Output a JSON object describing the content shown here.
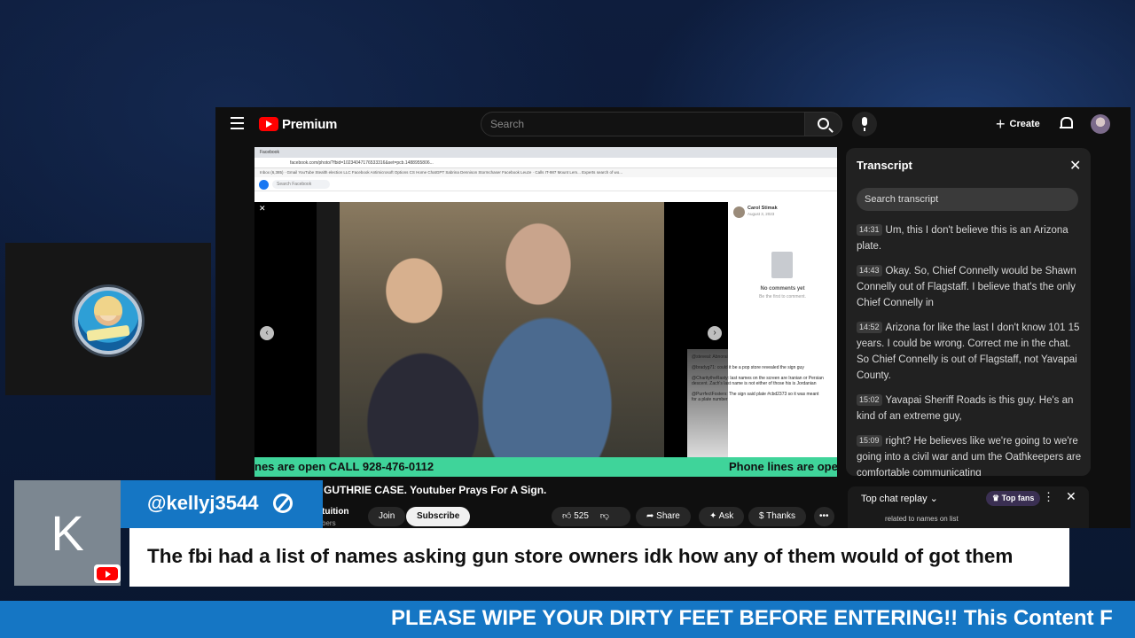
{
  "youtube": {
    "logo_text": "Premium",
    "search_placeholder": "Search",
    "create_label": "Create"
  },
  "video": {
    "browser_tab": "Facebook",
    "address": "facebook.com/photo/?fbid=10234047176533316&set=pcb.1488955806...",
    "bookmarks": "Inbox (6,385) · Gmail   YouTube   Stealth election LLC   Facebook   Antimicrosoft Options   CS Home   ChatGPT   Sabrina Dennison   Stormchaser   Facebook   Leuze · Calls   IT-987 Mount Lem...   Experts search of wo...",
    "fb_search_placeholder": "Search Facebook",
    "poster_name": "Carol Stimak",
    "poster_date": "August 3, 2023",
    "no_comments": "No comments yet",
    "be_first": "Be the first to comment.",
    "overlay_chat": [
      "@steveal: Abnorai",
      "@bradyg71: could it be a pop store revealed the sign guy",
      "@CharitytheRasty: last names on the screen are Iranian or Persian descent. Zach's last name is not either of those his is Jordanian",
      "@PurrfectFosters: The sign said plate #cbd2373 so it was meant for a plate number"
    ],
    "banner_text": "nes are open CALL 928-476-0112",
    "banner_text_2": "Phone lines are ope"
  },
  "title": "GUTHRIE CASE. Youtuber Prays For A Sign.",
  "channel": {
    "name": "tuition",
    "subs": "bers"
  },
  "actions": {
    "join": "Join",
    "subscribe": "Subscribe",
    "likes": "525",
    "share": "Share",
    "ask": "Ask",
    "thanks": "Thanks"
  },
  "transcript": {
    "title": "Transcript",
    "search_placeholder": "Search transcript",
    "items": [
      {
        "time": "14:31",
        "text": "Um, this I don't believe this is an Arizona plate."
      },
      {
        "time": "14:43",
        "text": "Okay. So, Chief Connelly would be Shawn Connelly out of Flagstaff. I believe that's the only Chief Connelly in"
      },
      {
        "time": "14:52",
        "text": "Arizona for like the last I don't know 101 15 years. I could be wrong. Correct me in the chat. So Chief Connelly is out of Flagstaff, not Yavapai County."
      },
      {
        "time": "15:02",
        "text": "Yavapai Sheriff Roads is this guy. He's an kind of an extreme guy,"
      },
      {
        "time": "15:09",
        "text": "right? He believes like we're going to we're going into a civil war and um the Oathkeepers are comfortable communicating"
      }
    ]
  },
  "live_chat": {
    "label": "Top chat replay",
    "top_fans": "Top fans",
    "message": "related to names on list"
  },
  "overlay": {
    "avatar_letter": "K",
    "username": "@kellyj3544",
    "message": "The fbi had a list of names asking gun store owners idk how any of them would of got them",
    "ticker": "PLEASE WIPE YOUR DIRTY FEET BEFORE ENTERING!! This Content F"
  },
  "colors": {
    "youtube_bg": "#0f0f0f",
    "overlay_blue": "#1576c4",
    "banner_green": "#3fd49a",
    "youtube_red": "#ff0000"
  }
}
